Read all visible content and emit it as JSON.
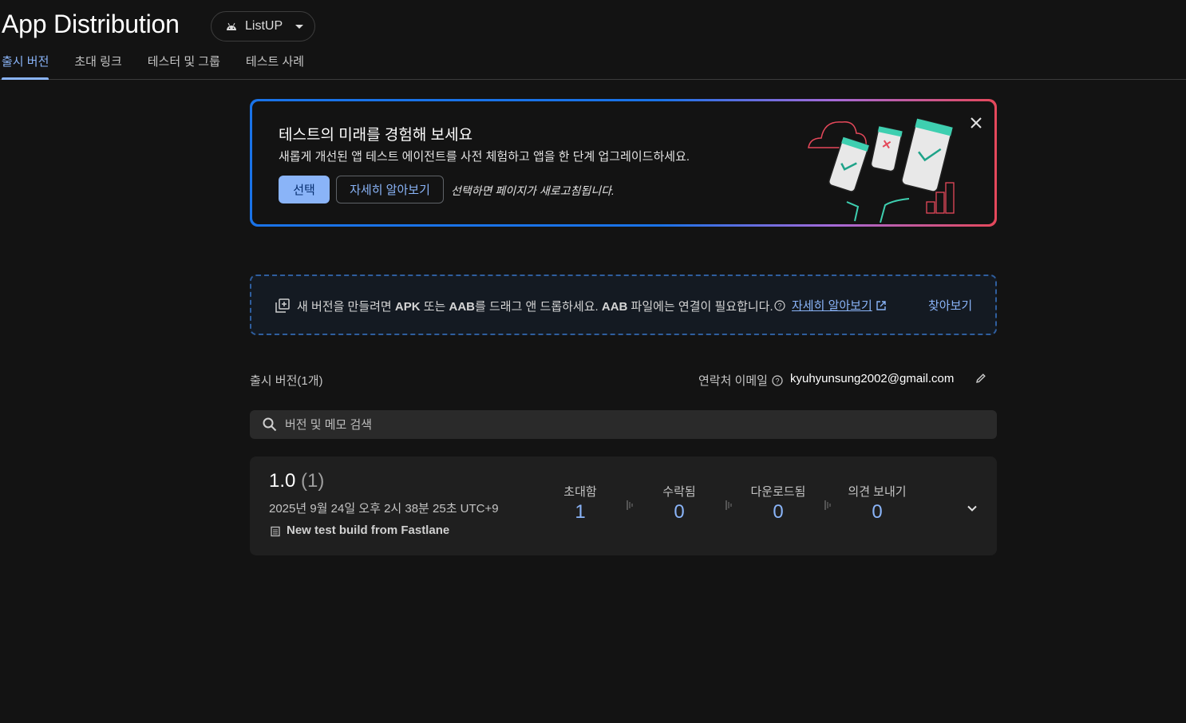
{
  "header": {
    "title": "App Distribution",
    "app_selector": {
      "label": "ListUP",
      "icon": "android-icon"
    },
    "tabs": [
      {
        "label": "출시 버전",
        "active": true
      },
      {
        "label": "초대 링크",
        "active": false
      },
      {
        "label": "테스터 및 그룹",
        "active": false
      },
      {
        "label": "테스트 사례",
        "active": false
      }
    ]
  },
  "banner": {
    "title": "테스트의 미래를 경험해 보세요",
    "description": "새롭게 개선된 앱 테스트 에이전트를 사전 체험하고 앱을 한 단계 업그레이드하세요.",
    "select_label": "선택",
    "learn_more_label": "자세히 알아보기",
    "note": "선택하면 페이지가 새로고침됩니다.",
    "gradient_colors": [
      "#1a73e8",
      "#a56ad8",
      "#e5485a"
    ]
  },
  "dropzone": {
    "text_parts": [
      "새 버전을 만들려면 ",
      "APK",
      " 또는 ",
      "AAB",
      "를 드래그 앤 드롭하세요. ",
      "AAB",
      " 파일에는 연결이 필요합니다."
    ],
    "learn_more_label": "자세히 알아보기",
    "browse_label": "찾아보기"
  },
  "releases": {
    "section_title": "출시 버전(1개)",
    "contact_label": "연락처 이메일",
    "contact_email": "kyuhyunsung2002@gmail.com",
    "search_placeholder": "버전 및 메모 검색",
    "items": [
      {
        "version": "1.0",
        "build": "(1)",
        "date": "2025년 9월 24일 오후 2시 38분 25초 UTC+9",
        "note": "New test build from Fastlane",
        "stats": [
          {
            "label": "초대함",
            "value": "1"
          },
          {
            "label": "수락됨",
            "value": "0"
          },
          {
            "label": "다운로드됨",
            "value": "0"
          },
          {
            "label": "의견 보내기",
            "value": "0"
          }
        ]
      }
    ]
  },
  "colors": {
    "background": "#131313",
    "accent": "#8ab4f8",
    "card": "#1f1f1f",
    "search": "#2a2a2a",
    "dropzone_border": "#2f5e9e"
  }
}
